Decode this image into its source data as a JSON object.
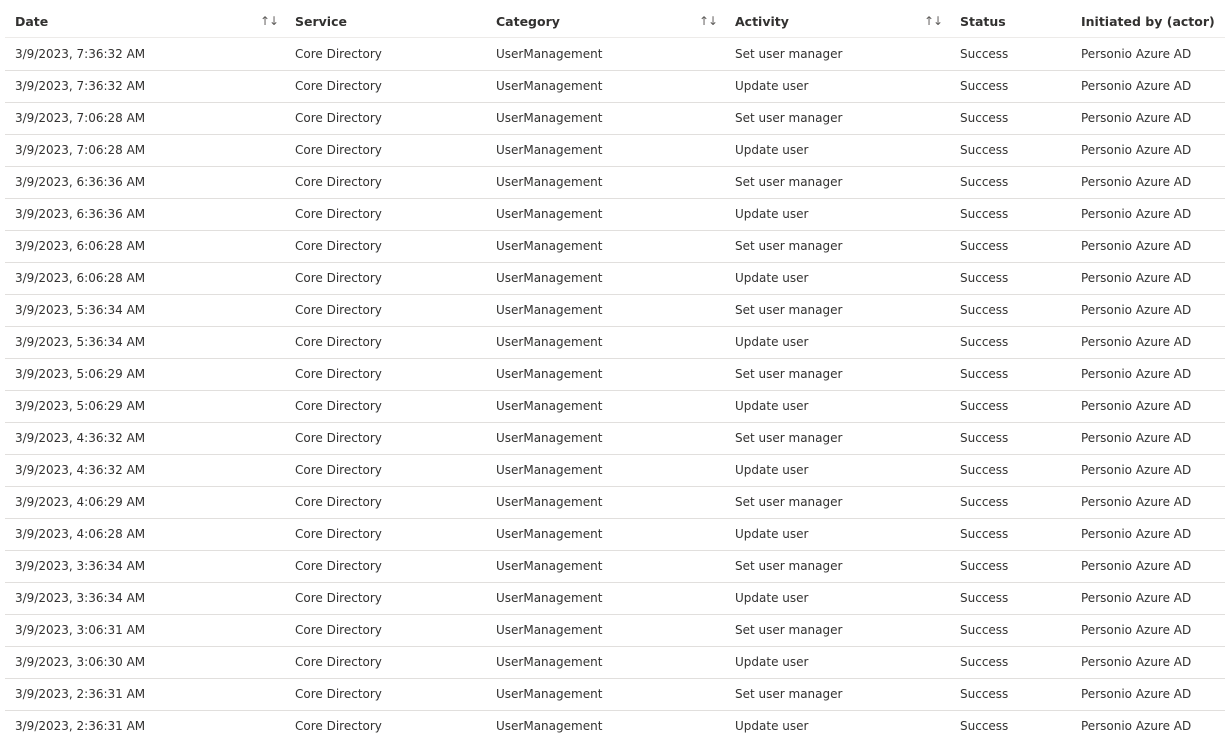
{
  "columns": {
    "date": "Date",
    "service": "Service",
    "category": "Category",
    "activity": "Activity",
    "status": "Status",
    "actor": "Initiated by (actor)"
  },
  "sort_glyph": "↑↓",
  "rows": [
    {
      "date": "3/9/2023, 7:36:32 AM",
      "service": "Core Directory",
      "category": "UserManagement",
      "activity": "Set user manager",
      "status": "Success",
      "actor": "Personio Azure AD"
    },
    {
      "date": "3/9/2023, 7:36:32 AM",
      "service": "Core Directory",
      "category": "UserManagement",
      "activity": "Update user",
      "status": "Success",
      "actor": "Personio Azure AD"
    },
    {
      "date": "3/9/2023, 7:06:28 AM",
      "service": "Core Directory",
      "category": "UserManagement",
      "activity": "Set user manager",
      "status": "Success",
      "actor": "Personio Azure AD"
    },
    {
      "date": "3/9/2023, 7:06:28 AM",
      "service": "Core Directory",
      "category": "UserManagement",
      "activity": "Update user",
      "status": "Success",
      "actor": "Personio Azure AD"
    },
    {
      "date": "3/9/2023, 6:36:36 AM",
      "service": "Core Directory",
      "category": "UserManagement",
      "activity": "Set user manager",
      "status": "Success",
      "actor": "Personio Azure AD"
    },
    {
      "date": "3/9/2023, 6:36:36 AM",
      "service": "Core Directory",
      "category": "UserManagement",
      "activity": "Update user",
      "status": "Success",
      "actor": "Personio Azure AD"
    },
    {
      "date": "3/9/2023, 6:06:28 AM",
      "service": "Core Directory",
      "category": "UserManagement",
      "activity": "Set user manager",
      "status": "Success",
      "actor": "Personio Azure AD"
    },
    {
      "date": "3/9/2023, 6:06:28 AM",
      "service": "Core Directory",
      "category": "UserManagement",
      "activity": "Update user",
      "status": "Success",
      "actor": "Personio Azure AD"
    },
    {
      "date": "3/9/2023, 5:36:34 AM",
      "service": "Core Directory",
      "category": "UserManagement",
      "activity": "Set user manager",
      "status": "Success",
      "actor": "Personio Azure AD"
    },
    {
      "date": "3/9/2023, 5:36:34 AM",
      "service": "Core Directory",
      "category": "UserManagement",
      "activity": "Update user",
      "status": "Success",
      "actor": "Personio Azure AD"
    },
    {
      "date": "3/9/2023, 5:06:29 AM",
      "service": "Core Directory",
      "category": "UserManagement",
      "activity": "Set user manager",
      "status": "Success",
      "actor": "Personio Azure AD"
    },
    {
      "date": "3/9/2023, 5:06:29 AM",
      "service": "Core Directory",
      "category": "UserManagement",
      "activity": "Update user",
      "status": "Success",
      "actor": "Personio Azure AD"
    },
    {
      "date": "3/9/2023, 4:36:32 AM",
      "service": "Core Directory",
      "category": "UserManagement",
      "activity": "Set user manager",
      "status": "Success",
      "actor": "Personio Azure AD"
    },
    {
      "date": "3/9/2023, 4:36:32 AM",
      "service": "Core Directory",
      "category": "UserManagement",
      "activity": "Update user",
      "status": "Success",
      "actor": "Personio Azure AD"
    },
    {
      "date": "3/9/2023, 4:06:29 AM",
      "service": "Core Directory",
      "category": "UserManagement",
      "activity": "Set user manager",
      "status": "Success",
      "actor": "Personio Azure AD"
    },
    {
      "date": "3/9/2023, 4:06:28 AM",
      "service": "Core Directory",
      "category": "UserManagement",
      "activity": "Update user",
      "status": "Success",
      "actor": "Personio Azure AD"
    },
    {
      "date": "3/9/2023, 3:36:34 AM",
      "service": "Core Directory",
      "category": "UserManagement",
      "activity": "Set user manager",
      "status": "Success",
      "actor": "Personio Azure AD"
    },
    {
      "date": "3/9/2023, 3:36:34 AM",
      "service": "Core Directory",
      "category": "UserManagement",
      "activity": "Update user",
      "status": "Success",
      "actor": "Personio Azure AD"
    },
    {
      "date": "3/9/2023, 3:06:31 AM",
      "service": "Core Directory",
      "category": "UserManagement",
      "activity": "Set user manager",
      "status": "Success",
      "actor": "Personio Azure AD"
    },
    {
      "date": "3/9/2023, 3:06:30 AM",
      "service": "Core Directory",
      "category": "UserManagement",
      "activity": "Update user",
      "status": "Success",
      "actor": "Personio Azure AD"
    },
    {
      "date": "3/9/2023, 2:36:31 AM",
      "service": "Core Directory",
      "category": "UserManagement",
      "activity": "Set user manager",
      "status": "Success",
      "actor": "Personio Azure AD"
    },
    {
      "date": "3/9/2023, 2:36:31 AM",
      "service": "Core Directory",
      "category": "UserManagement",
      "activity": "Update user",
      "status": "Success",
      "actor": "Personio Azure AD"
    }
  ]
}
